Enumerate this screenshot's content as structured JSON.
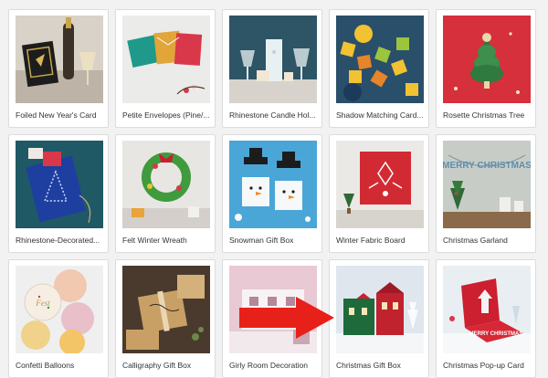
{
  "products": [
    {
      "title": "Foiled New Year's Card",
      "thumb_icon": "new-years-card-image",
      "bg": "#d9d2c8"
    },
    {
      "title": "Petite Envelopes (Pine/...",
      "thumb_icon": "envelopes-image",
      "bg": "#ebebea"
    },
    {
      "title": "Rhinestone Candle Hol...",
      "thumb_icon": "candle-holder-image",
      "bg": "#2d5566"
    },
    {
      "title": "Shadow Matching Card...",
      "thumb_icon": "matching-cards-image",
      "bg": "#2a4f6b"
    },
    {
      "title": "Rosette Christmas Tree",
      "thumb_icon": "rosette-tree-image",
      "bg": "#d6303c"
    },
    {
      "title": "Rhinestone-Decorated...",
      "thumb_icon": "rhinestone-card-image",
      "bg": "#1f5966"
    },
    {
      "title": "Felt Winter Wreath",
      "thumb_icon": "wreath-image",
      "bg": "#e8e6e3"
    },
    {
      "title": "Snowman Gift Box",
      "thumb_icon": "snowman-box-image",
      "bg": "#4aa6d6"
    },
    {
      "title": "Winter Fabric Board",
      "thumb_icon": "fabric-board-image",
      "bg": "#ebe9e6"
    },
    {
      "title": "Christmas Garland",
      "thumb_icon": "garland-image",
      "bg": "#c7ccc6"
    },
    {
      "title": "Confetti Balloons",
      "thumb_icon": "balloons-image",
      "bg": "#efefef"
    },
    {
      "title": "Calligraphy Gift Box",
      "thumb_icon": "gift-box-image",
      "bg": "#4a3a2d"
    },
    {
      "title": "Girly Room Decoration",
      "thumb_icon": "room-decoration-image",
      "bg": "#e8c9d4"
    },
    {
      "title": "Christmas Gift Box",
      "thumb_icon": "christmas-gift-box-image",
      "bg": "#dfe6ee"
    },
    {
      "title": "Christmas Pop-up Card",
      "thumb_icon": "popup-card-image",
      "bg": "#e9eef2"
    }
  ],
  "thumb_text": {
    "garland": "MERRY CHRISTMAS",
    "balloon": "Fest",
    "popup_card": "MERRY CHRISTMAS"
  },
  "highlight": {
    "icon": "red-arrow-icon",
    "color": "#e8201a"
  }
}
